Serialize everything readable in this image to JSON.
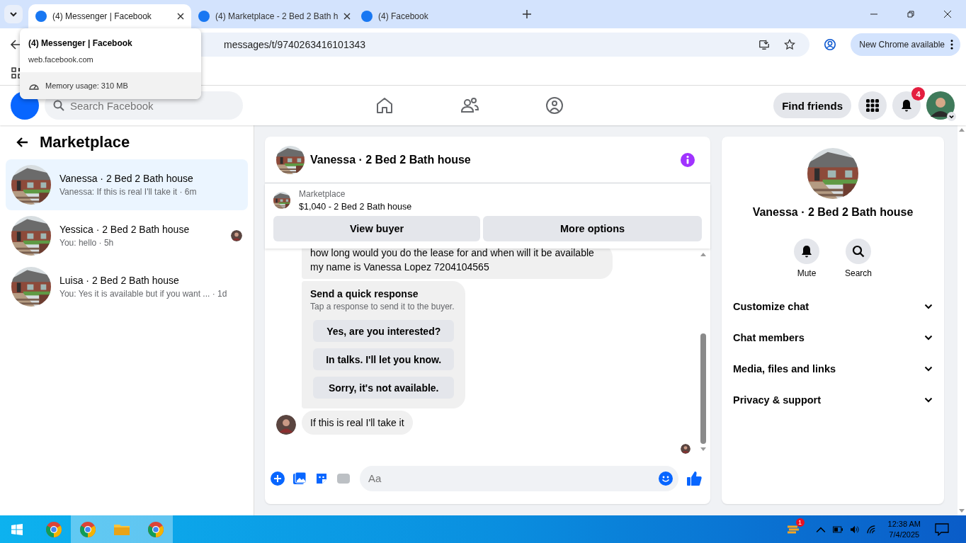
{
  "browser": {
    "tabs": [
      {
        "title": "(4) Messenger | Facebook",
        "selected": true
      },
      {
        "title": "(4) Marketplace - 2 Bed 2 Bath h",
        "selected": false
      },
      {
        "title": "(4) Facebook",
        "selected": false
      }
    ],
    "url": "messages/t/9740263416101343",
    "update_button": "New Chrome available",
    "hover_card": {
      "title": "(4) Messenger | Facebook",
      "domain": "web.facebook.com",
      "memory": "Memory usage: 310 MB"
    }
  },
  "header": {
    "search": {
      "placeholder": "Search Facebook"
    },
    "find_friends": "Find friends",
    "notification_count": "4"
  },
  "sidebar": {
    "title": "Marketplace",
    "chats": [
      {
        "name": "Vanessa · 2 Bed 2 Bath house",
        "preview": "Vanessa: If this is real I'll take it · 6m",
        "selected": true,
        "seen": false
      },
      {
        "name": "Yessica · 2 Bed 2 Bath house",
        "preview": "You: hello · 5h",
        "selected": false,
        "seen": true
      },
      {
        "name": "Luisa · 2 Bed 2 Bath house",
        "preview": "You: Yes it is available but if you want ... · 1d",
        "selected": false,
        "seen": false
      }
    ]
  },
  "chat": {
    "title": "Vanessa · 2 Bed 2 Bath house",
    "listing": {
      "label": "Marketplace",
      "title": "$1,040 - 2 Bed 2 Bath house"
    },
    "actions": [
      "View buyer",
      "More options"
    ],
    "messages": [
      {
        "kind": "text",
        "lines": [
          "how long would you do the lease for and when will it be available",
          "my name is Vanessa Lopez 7204104565"
        ],
        "avatar": false
      },
      {
        "kind": "quick_responses",
        "title": "Send a quick response",
        "hint": "Tap a response to send it to the buyer.",
        "options": [
          "Yes, are you interested?",
          "In talks. I'll let you know.",
          "Sorry, it's not available."
        ]
      },
      {
        "kind": "text",
        "lines": [
          "If this is real I'll take it"
        ],
        "avatar": true
      }
    ],
    "composer": {
      "placeholder": "Aa"
    }
  },
  "info": {
    "title": "Vanessa · 2 Bed 2 Bath house",
    "actions": [
      {
        "label": "Mute",
        "kind": "bell"
      },
      {
        "label": "Search",
        "kind": "search"
      }
    ],
    "sections": [
      "Customize chat",
      "Chat members",
      "Media, files and links",
      "Privacy & support"
    ]
  },
  "taskbar": {
    "time": "12:38 AM",
    "date": "7/4/2025",
    "tray_badge": "1"
  }
}
